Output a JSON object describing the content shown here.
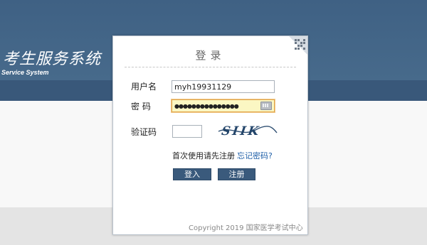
{
  "brand": {
    "title": "考生服务系统",
    "subtitle": "Service System"
  },
  "login": {
    "title": "登录",
    "username_label": "用户名",
    "username_value": "myh19931129",
    "password_label": "密 码",
    "password_value": "●●●●●●●●●●●●●●●",
    "captcha_label": "验证码",
    "captcha_value": "",
    "captcha_image_text": "SIIK",
    "first_use_hint": "首次使用请先注册",
    "forgot_link": "忘记密码?",
    "login_button": "登入",
    "register_button": "注册"
  },
  "footer": {
    "copyright": "Copyright 2019 国家医学考试中心"
  },
  "colors": {
    "header": "#476a8b",
    "header_band": "#39587a",
    "button": "#3a5a7c",
    "link": "#1f5fa8",
    "password_highlight": "#fbf7c3"
  },
  "icons": {
    "qr": "qr-code-icon",
    "keyboard": "keyboard-icon"
  }
}
